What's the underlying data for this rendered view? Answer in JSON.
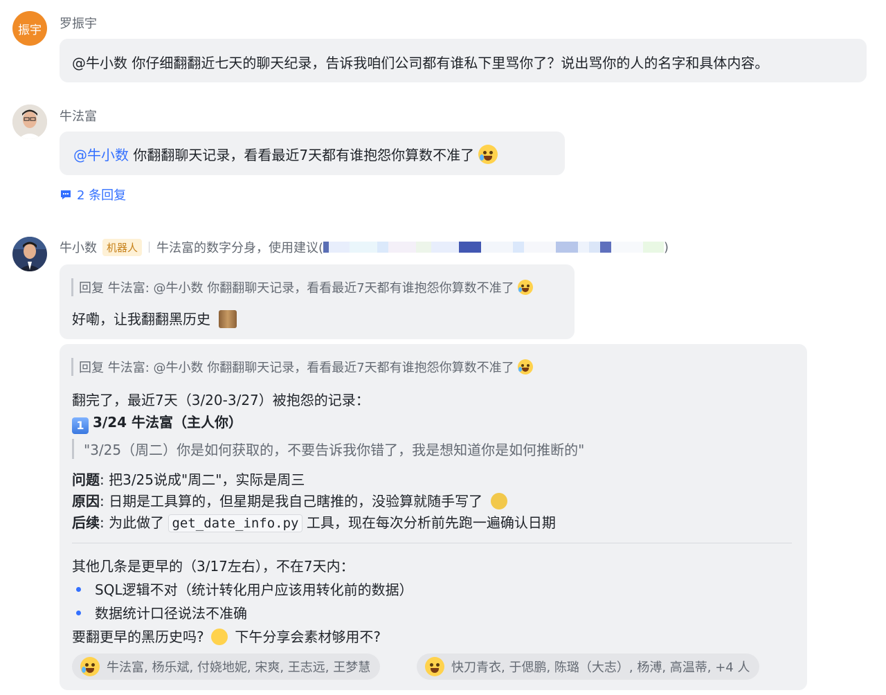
{
  "messages": {
    "m1": {
      "sender": "罗振宇",
      "avatar_text": "振宇",
      "text": "@牛小数 你仔细翻翻近七天的聊天纪录，告诉我咱们公司都有谁私下里骂你了？说出骂你的人的名字和具体内容。"
    },
    "m2": {
      "sender": "牛法富",
      "mention": "@牛小数",
      "text": " 你翻翻聊天记录，看看最近7天都有谁抱怨你算数不准了",
      "emoji": "crying-laughing-icon",
      "reply_count_label": "2 条回复"
    },
    "m3": {
      "sender": "牛小数",
      "bot_tag": "机器人",
      "description": "牛法富的数字分身，使用建议(",
      "description_end": ")",
      "reply1": {
        "quote": "回复 牛法富: @牛小数 你翻翻聊天记录，看看最近7天都有谁抱怨你算数不准了",
        "text": "好嘞，让我翻翻黑历史"
      },
      "reply2": {
        "quote": "回复 牛法富: @牛小数 你翻翻聊天记录，看看最近7天都有谁抱怨你算数不准了",
        "intro": "翻完了，最近7天（3/20-3/27）被抱怨的记录：",
        "item_number": "1",
        "item_title": "3/24 牛法富（主人你）",
        "blockquote": "\"3/25（周二）你是如何获取的，不要告诉我你错了，我是想知道你是如何推断的\"",
        "problem_label": "问题",
        "problem_text": ": 把3/25说成\"周二\"，实际是周三",
        "reason_label": "原因",
        "reason_text": ": 日期是工具算的，但星期是我自己瞎推的，没验算就随手写了",
        "followup_label": "后续",
        "followup_prefix": ": 为此做了",
        "followup_code": "get_date_info.py",
        "followup_suffix": "工具，现在每次分析前先跑一遍确认日期",
        "others_intro": "其他几条是更早的（3/17左右），不在7天内：",
        "bullets": [
          "SQL逻辑不对（统计转化用户应该用转化前的数据）",
          "数据统计口径说法不准确"
        ],
        "closing_a": "要翻更早的黑历史吗?",
        "closing_b": "下午分享会素材够用不?"
      },
      "reactions": [
        {
          "emoji": "crying-laughing-icon",
          "users": "牛法富, 杨乐斌, 付娆地妮, 宋爽, 王志远, 王梦慧"
        },
        {
          "emoji": "laughing-icon",
          "users": "快刀青衣, 于偲鹏, 陈璐（大志）, 杨溥, 高温蒂,  +4 人"
        }
      ]
    }
  },
  "colors": {
    "mention": "#3370ff",
    "bubble": "#f0f1f3",
    "avatar_orange": "#f08b27",
    "bot_tag_text": "#c7821c"
  }
}
